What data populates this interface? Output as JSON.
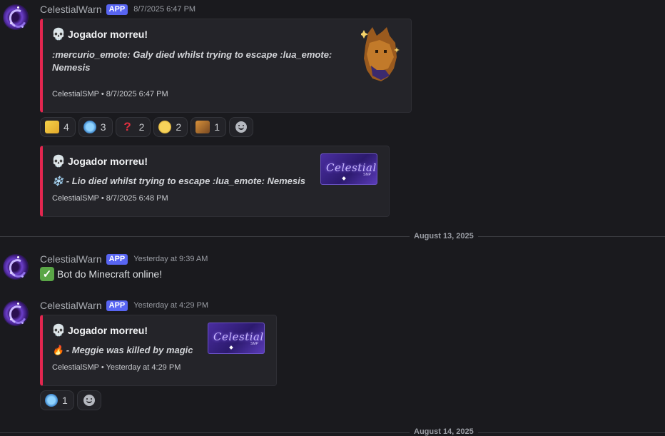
{
  "messages": [
    {
      "username": "CelestialWarn",
      "badge": "APP",
      "timestamp": "8/7/2025 6:47 PM",
      "embed": {
        "title": "Jogador morreu!",
        "description": ":mercurio_emote: Galy died whilst trying to escape :lua_emote: Nemesis",
        "footer": "CelestialSMP • 8/7/2025 6:47 PM"
      },
      "reactions": [
        {
          "emoji": "banana-emoji",
          "count": "4"
        },
        {
          "emoji": "crying-emoji",
          "count": "3"
        },
        {
          "emoji": "question-mark-emoji",
          "count": "2"
        },
        {
          "emoji": "sweat-smile-emoji",
          "count": "2"
        },
        {
          "emoji": "cat-emoji",
          "count": "1"
        }
      ]
    },
    {
      "embed": {
        "title": "Jogador morreu!",
        "description": "❄️ - Lio died whilst trying to escape :lua_emote: Nemesis",
        "footer": "CelestialSMP • 8/7/2025 6:48 PM",
        "thumbnail_text": "Celestial",
        "thumbnail_sub": "SMP"
      }
    },
    {
      "username": "CelestialWarn",
      "badge": "APP",
      "timestamp": "Yesterday at 9:39 AM",
      "content": "Bot do Minecraft online!"
    },
    {
      "username": "CelestialWarn",
      "badge": "APP",
      "timestamp": "Yesterday at 4:29 PM",
      "embed": {
        "title": "Jogador morreu!",
        "description": "🔥 - Meggie was killed by magic",
        "footer": "CelestialSMP • Yesterday at 4:29 PM",
        "thumbnail_text": "Celestial",
        "thumbnail_sub": "SMP"
      },
      "reactions": [
        {
          "emoji": "crying-emoji",
          "count": "1"
        }
      ]
    }
  ],
  "dividers": [
    {
      "label": "August 13, 2025"
    },
    {
      "label": "August 14, 2025"
    }
  ],
  "colors": {
    "background": "#1a1a1e",
    "embed_accent": "#e3264f",
    "app_badge": "#5865f2"
  }
}
